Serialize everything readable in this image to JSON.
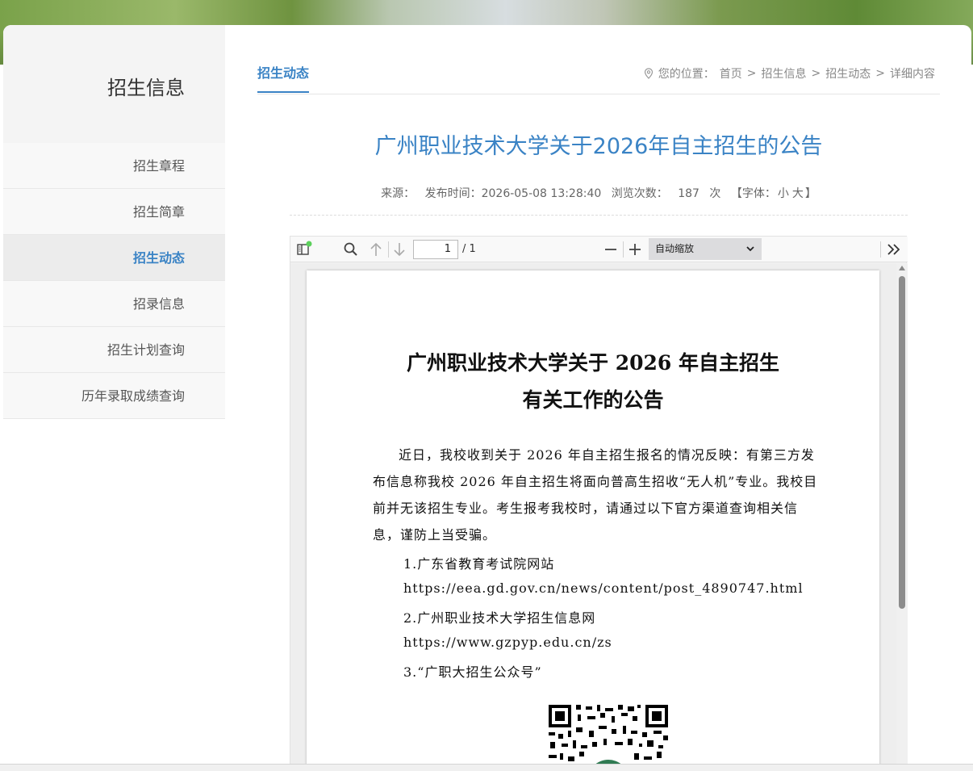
{
  "sidebar": {
    "title": "招生信息",
    "items": [
      {
        "label": "招生章程",
        "active": false
      },
      {
        "label": "招生简章",
        "active": false
      },
      {
        "label": "招生动态",
        "active": true
      },
      {
        "label": "招录信息",
        "active": false
      },
      {
        "label": "招生计划查询",
        "active": false
      },
      {
        "label": "历年录取成绩查询",
        "active": false
      }
    ]
  },
  "tabbar": {
    "current": "招生动态",
    "breadcrumb": {
      "prefix": "您的位置：",
      "items": [
        "首页",
        "招生信息",
        "招生动态",
        "详细内容"
      ],
      "sep": ">"
    }
  },
  "article": {
    "title": "广州职业技术大学关于2026年自主招生的公告",
    "meta": {
      "source_label": "来源：",
      "publish_label": "发布时间：",
      "publish_time": "2026-05-08 13:28:40",
      "views_label": "浏览次数：",
      "views": "187",
      "views_unit": "次",
      "font_open": "【字体：",
      "font_small": "小",
      "font_large": "大",
      "font_close": "】"
    }
  },
  "pdf": {
    "page_current": "1",
    "page_total": "/ 1",
    "zoom": "自动缩放",
    "doc_title_line1": "广州职业技术大学关于 2026 年自主招生",
    "doc_title_line2": "有关工作的公告",
    "paragraph": "近日，我校收到关于 2026 年自主招生报名的情况反映：有第三方发布信息称我校 2026 年自主招生将面向普高生招收“无人机”专业。我校目前并无该招生专业。考生报考我校时，请通过以下官方渠道查询相关信息，谨防上当受骗。",
    "item1": "1.广东省教育考试院网站",
    "item1_url": "https://eea.gd.gov.cn/news/content/post_4890747.html",
    "item2": "2.广州职业技术大学招生信息网",
    "item2_url": "https://www.gzpyp.edu.cn/zs",
    "item3": "3.“广职大招生公众号”"
  },
  "colors": {
    "accent": "#3a83c5",
    "text": "#555555"
  }
}
